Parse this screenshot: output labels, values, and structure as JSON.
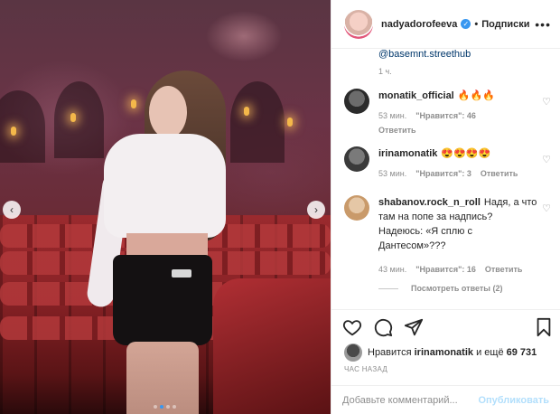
{
  "post": {
    "username": "nadyadorofeeva",
    "separator": "•",
    "follow_label": "Подписки",
    "more_label": "•••",
    "photo_alt": "Девушка в белом свитере в зрительном зале"
  },
  "caption": {
    "mention": "@basemnt.streethub",
    "time": "1 ч."
  },
  "comments": [
    {
      "username": "monatik_official",
      "text": "🔥🔥🔥",
      "time": "53 мин.",
      "likes": "\"Нравится\": 46",
      "reply": "Ответить",
      "avatar_color": "#2b2b2b"
    },
    {
      "username": "irinamonatik",
      "text": "😍😍😍😍",
      "time": "53 мин.",
      "likes": "\"Нравится\": 3",
      "reply": "Ответить",
      "avatar_color": "#3a3a3a"
    },
    {
      "username": "shabanov.rock_n_roll",
      "text": "Надя, а что там на попе за надпись? Надеюсь: «Я сплю с Дантесом»???",
      "time": "43 мин.",
      "likes": "\"Нравится\": 16",
      "reply": "Ответить",
      "avatar_color": "#c99a6a"
    }
  ],
  "replies_label": "Посмотреть ответы (2)",
  "likes": {
    "prefix": "Нравится",
    "user": "irinamonatik",
    "and": "и ещё",
    "count": "69 731"
  },
  "ago": "ЧАС НАЗАД",
  "add_comment": {
    "placeholder": "Добавьте комментарий...",
    "publish_label": "Опубликовать"
  },
  "icons": {
    "heart": "heart-icon",
    "comment": "comment-icon",
    "share": "share-icon",
    "save": "bookmark-icon"
  },
  "colors": {
    "link": "#00376b",
    "accent": "#3897f0",
    "muted": "#8e8e8e",
    "publish_disabled": "#b2dffc"
  }
}
